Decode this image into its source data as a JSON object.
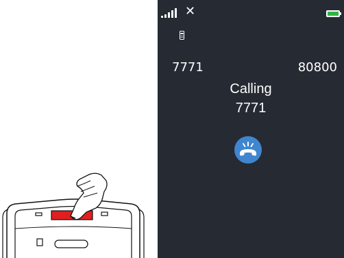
{
  "status_bar": {
    "signal_icon": "signal-bars-icon",
    "network_mark": "✕",
    "battery_icon": "battery-icon",
    "battery_color": "#2fb344"
  },
  "sim_icon": "sim-card-icon",
  "call": {
    "dialed_number": "7771",
    "right_number": "80800",
    "status_label": "Calling",
    "calling_number": "7771"
  },
  "end_call": {
    "icon": "hang-up-phone-icon",
    "color": "#3f86cf"
  },
  "illustration": {
    "description_icon": "hand-pressing-phone-button-icon",
    "highlight_color": "#e02020"
  },
  "colors": {
    "screen_background": "#262a33",
    "text": "#ffffff"
  }
}
